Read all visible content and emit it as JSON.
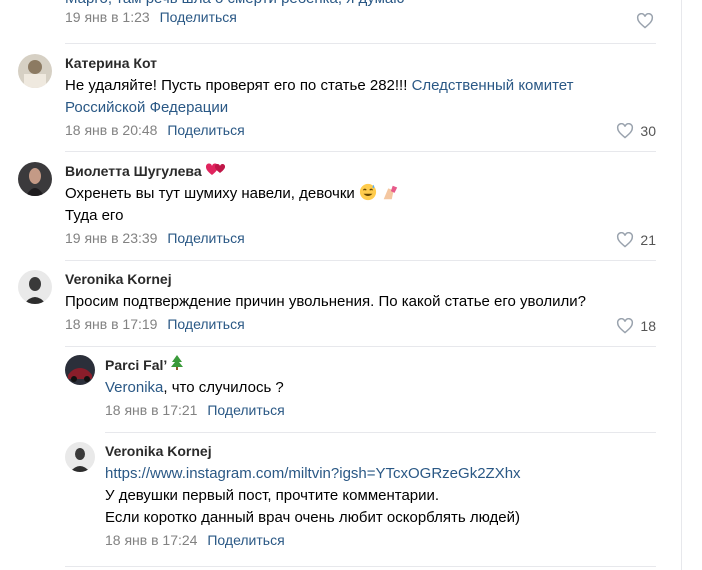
{
  "top_partial": {
    "text_fragment": "Марго, там речь шла о смерти ребенка, я думаю",
    "date": "19 янв в 1:23",
    "share": "Поделиться"
  },
  "comments": [
    {
      "name": "Катерина Кот",
      "text": "Не удаляйте! Пусть проверят его по статье 282!!!",
      "link": "Следственный комитет Российской Федерации",
      "date": "18 янв в 20:48",
      "share": "Поделиться",
      "likes": "30"
    },
    {
      "name": "Виолетта Шугулева",
      "line1": "Охренеть вы тут шумиху навели, девочки",
      "line2": "Туда его",
      "date": "19 янв в 23:39",
      "share": "Поделиться",
      "likes": "21"
    },
    {
      "name": "Veronika Kornej",
      "text": "Просим подтверждение причин увольнения. По какой статье его уволили?",
      "date": "18 янв в 17:19",
      "share": "Поделиться",
      "likes": "18"
    }
  ],
  "replies": [
    {
      "name": "Parci Fal’",
      "mention": "Veronika",
      "text": ", что случилось ?",
      "date": "18 янв в 17:21",
      "share": "Поделиться"
    },
    {
      "name": "Veronika Kornej",
      "url": "https://www.instagram.com/miltvin?igsh=YTcxOGRzeGk2ZXhx",
      "line1": "У девушки первый пост, прочтите комментарии.",
      "line2": "Если коротко данный врач очень любит оскорблять людей)",
      "date": "18 янв в 17:24",
      "share": "Поделиться"
    }
  ]
}
